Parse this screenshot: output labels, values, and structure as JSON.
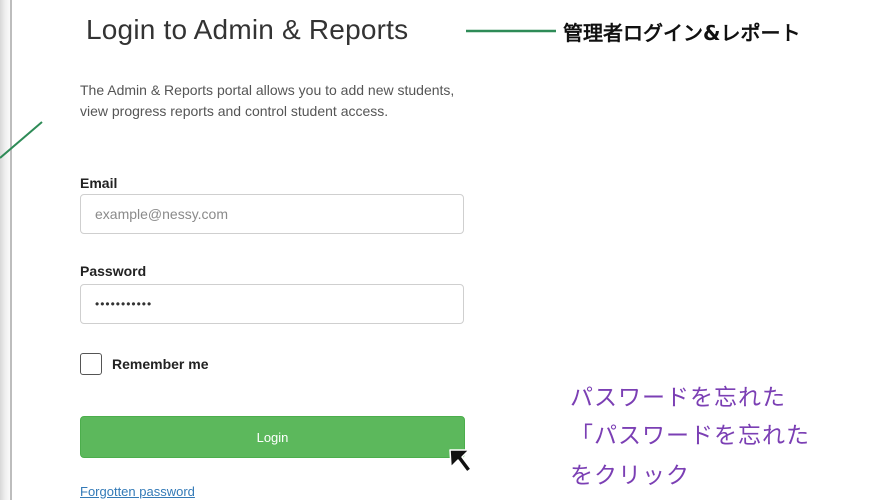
{
  "page": {
    "title": "Login to Admin & Reports",
    "description": "The Admin & Reports portal allows you to add new students, view progress reports and control student access."
  },
  "form": {
    "email_label": "Email",
    "email_placeholder": "example@nessy.com",
    "email_value": "",
    "password_label": "Password",
    "password_value": "•••••••••••",
    "remember_label": "Remember me",
    "remember_checked": false,
    "login_label": "Login",
    "forgot_label": "Forgotten password"
  },
  "annotations": {
    "title_jp": "管理者ログイン&レポート",
    "forgot_line1": "パスワードを忘れた",
    "forgot_line2": "「パスワードを忘れた",
    "forgot_line3": "をクリック"
  },
  "colors": {
    "login_button": "#5cb85c",
    "link": "#337ab7",
    "callout_line": "#2e8b57",
    "annotation_text": "#7b3fb4"
  },
  "icons": [
    "mouse-cursor-icon"
  ]
}
